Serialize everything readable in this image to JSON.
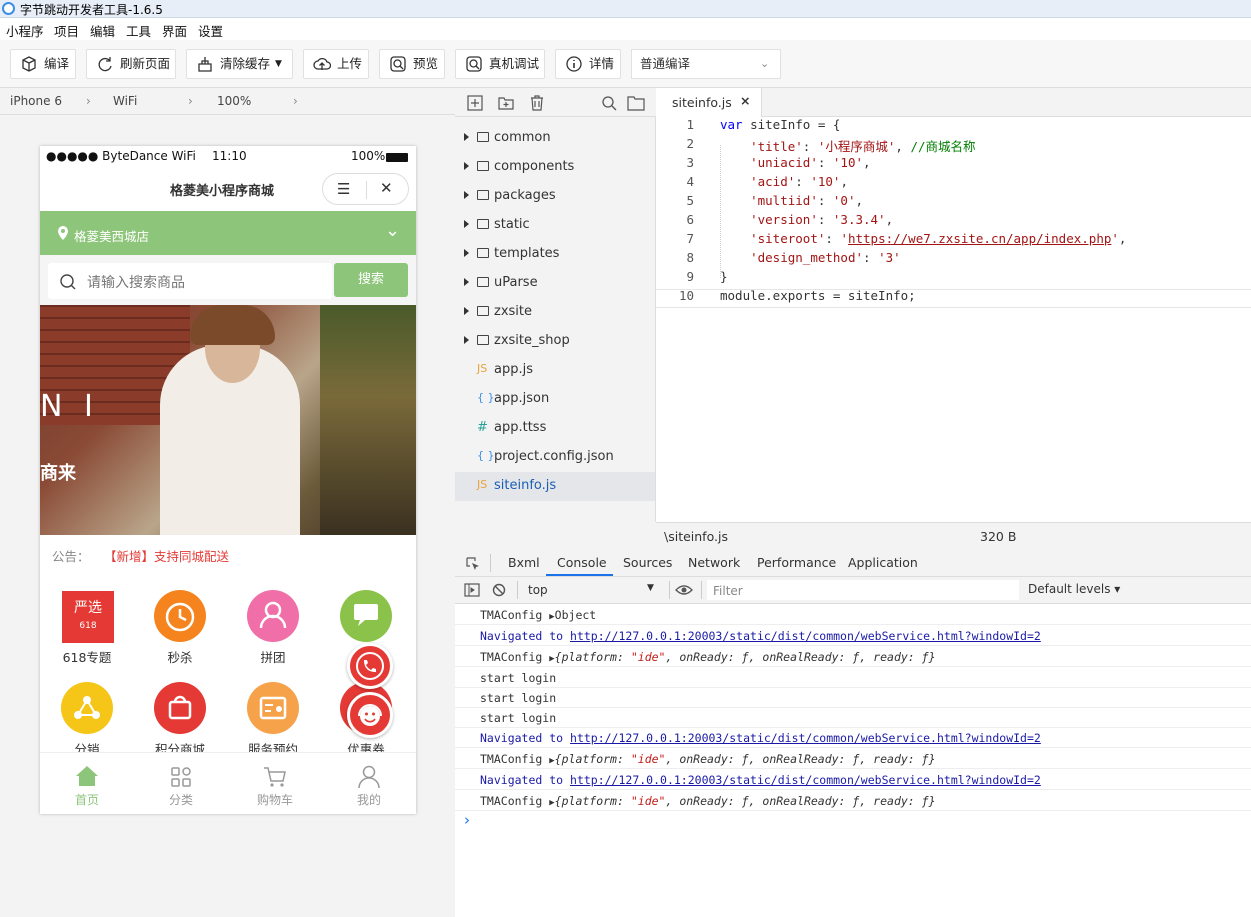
{
  "window": {
    "title": "字节跳动开发者工具-1.6.5"
  },
  "menu": [
    "小程序",
    "项目",
    "编辑",
    "工具",
    "界面",
    "设置"
  ],
  "toolbar": {
    "compile": "编译",
    "refresh": "刷新页面",
    "clear_cache": "清除缓存",
    "upload": "上传",
    "preview": "预览",
    "remote_debug": "真机调试",
    "details": "详情",
    "compile_mode": "普通编译"
  },
  "device": {
    "model": "iPhone 6",
    "network": "WiFi",
    "zoom": "100%"
  },
  "phone": {
    "status": {
      "carrier": "●●●●● ByteDance WiFi",
      "time": "11:10",
      "battery": "100%"
    },
    "nav_title": "格菱美小程序商城",
    "store_name": "格菱美西城店",
    "search_placeholder": "请输入搜索商品",
    "search_button": "搜索",
    "banner_text1": "N I",
    "banner_text2": "商来",
    "notice_label": "公告：",
    "notice_text": "【新增】支持同城配送",
    "grid": [
      {
        "label": "618专题",
        "color": "#e53935",
        "icon": "yanxuan-618-icon",
        "badge": "严选",
        "sub": "618"
      },
      {
        "label": "秒杀",
        "color": "#f5841f",
        "icon": "alarm-clock-icon"
      },
      {
        "label": "拼团",
        "color": "#f06fa8",
        "icon": "group-person-icon"
      },
      {
        "label": "",
        "color": "#8bc34a",
        "icon": "chat-group-icon"
      },
      {
        "label": "分销",
        "color": "#f5c518",
        "icon": "distribution-icon"
      },
      {
        "label": "积分商城",
        "color": "#e53935",
        "icon": "gift-bag-icon"
      },
      {
        "label": "服务预约",
        "color": "#f5a24b",
        "icon": "reservation-icon"
      },
      {
        "label": "优惠券",
        "color": "#e53935",
        "icon": "coupon-icon"
      }
    ],
    "tabs": [
      {
        "label": "首页",
        "icon": "home-icon",
        "active": true
      },
      {
        "label": "分类",
        "icon": "category-icon"
      },
      {
        "label": "购物车",
        "icon": "cart-icon"
      },
      {
        "label": "我的",
        "icon": "user-icon"
      }
    ]
  },
  "files": [
    {
      "name": "common",
      "type": "folder"
    },
    {
      "name": "components",
      "type": "folder"
    },
    {
      "name": "packages",
      "type": "folder"
    },
    {
      "name": "static",
      "type": "folder"
    },
    {
      "name": "templates",
      "type": "folder"
    },
    {
      "name": "uParse",
      "type": "folder"
    },
    {
      "name": "zxsite",
      "type": "folder"
    },
    {
      "name": "zxsite_shop",
      "type": "folder"
    },
    {
      "name": "app.js",
      "type": "js",
      "glyph": "JS"
    },
    {
      "name": "app.json",
      "type": "json",
      "glyph": "{ }"
    },
    {
      "name": "app.ttss",
      "type": "ttss",
      "glyph": "#"
    },
    {
      "name": "project.config.json",
      "type": "json",
      "glyph": "{ }"
    },
    {
      "name": "siteinfo.js",
      "type": "js",
      "glyph": "JS",
      "active": true
    }
  ],
  "editor": {
    "tab": "siteinfo.js",
    "close": "×",
    "path": "\\siteinfo.js",
    "size": "320 B",
    "lines": [
      "1",
      "2",
      "3",
      "4",
      "5",
      "6",
      "7",
      "8",
      "9",
      "10"
    ]
  },
  "devtools": {
    "tabs": [
      "Bxml",
      "Console",
      "Sources",
      "Network",
      "Performance",
      "Application"
    ],
    "active": "Console",
    "context": "top",
    "filter_placeholder": "Filter",
    "levels": "Default levels ▾"
  },
  "console": [
    {
      "kind": "obj",
      "text": "TMAConfig ",
      "rest": "Object"
    },
    {
      "kind": "nav",
      "text": "Navigated to ",
      "url": "http://127.0.0.1:20003/static/dist/common/webService.html?windowId=2"
    },
    {
      "kind": "cfg",
      "text": "TMAConfig "
    },
    {
      "kind": "plain",
      "text": "start login"
    },
    {
      "kind": "plain",
      "text": "start login"
    },
    {
      "kind": "plain",
      "text": "start login"
    },
    {
      "kind": "nav",
      "text": "Navigated to ",
      "url": "http://127.0.0.1:20003/static/dist/common/webService.html?windowId=2"
    },
    {
      "kind": "cfg",
      "text": "TMAConfig "
    },
    {
      "kind": "nav",
      "text": "Navigated to ",
      "url": "http://127.0.0.1:20003/static/dist/common/webService.html?windowId=2"
    },
    {
      "kind": "cfg",
      "text": "TMAConfig "
    }
  ],
  "console_prompt": "›",
  "colors": {
    "accent": "#8dc57a",
    "link": "#1a1aa6",
    "danger": "#e53935"
  }
}
